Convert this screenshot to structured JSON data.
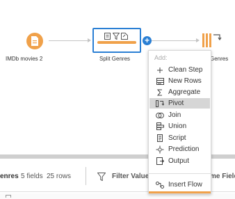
{
  "flow": {
    "input_node": {
      "label": "IMDb movies 2",
      "color": "#f0a14a",
      "icon": "file-icon"
    },
    "clean_node": {
      "label": "Split Genres",
      "border_color": "#2a7fd4",
      "bar_color": "#f0a14a",
      "icons": [
        "clean-icon",
        "filter-icon",
        "rename-icon"
      ]
    },
    "add_button": {
      "label": "+",
      "color": "#2a7fd4"
    },
    "output_node": {
      "label": "Genres",
      "icon": "pivot-icon",
      "color": "#f0a14a"
    }
  },
  "menu": {
    "header": "Add:",
    "items": [
      {
        "label": "Clean Step",
        "icon": "plus-icon"
      },
      {
        "label": "New Rows",
        "icon": "new-rows-icon"
      },
      {
        "label": "Aggregate",
        "icon": "sigma-icon"
      },
      {
        "label": "Pivot",
        "icon": "pivot-icon",
        "active": true
      },
      {
        "label": "Join",
        "icon": "join-icon"
      },
      {
        "label": "Union",
        "icon": "union-icon"
      },
      {
        "label": "Script",
        "icon": "script-icon"
      },
      {
        "label": "Prediction",
        "icon": "prediction-icon"
      },
      {
        "label": "Output",
        "icon": "output-icon"
      }
    ],
    "footer_item": {
      "label": "Insert Flow",
      "icon": "insert-flow-icon"
    }
  },
  "info_bar": {
    "title": "enres",
    "fields": "5 fields",
    "rows": "25 rows",
    "filter_label": "Filter Value",
    "rename_label": "me Field"
  }
}
